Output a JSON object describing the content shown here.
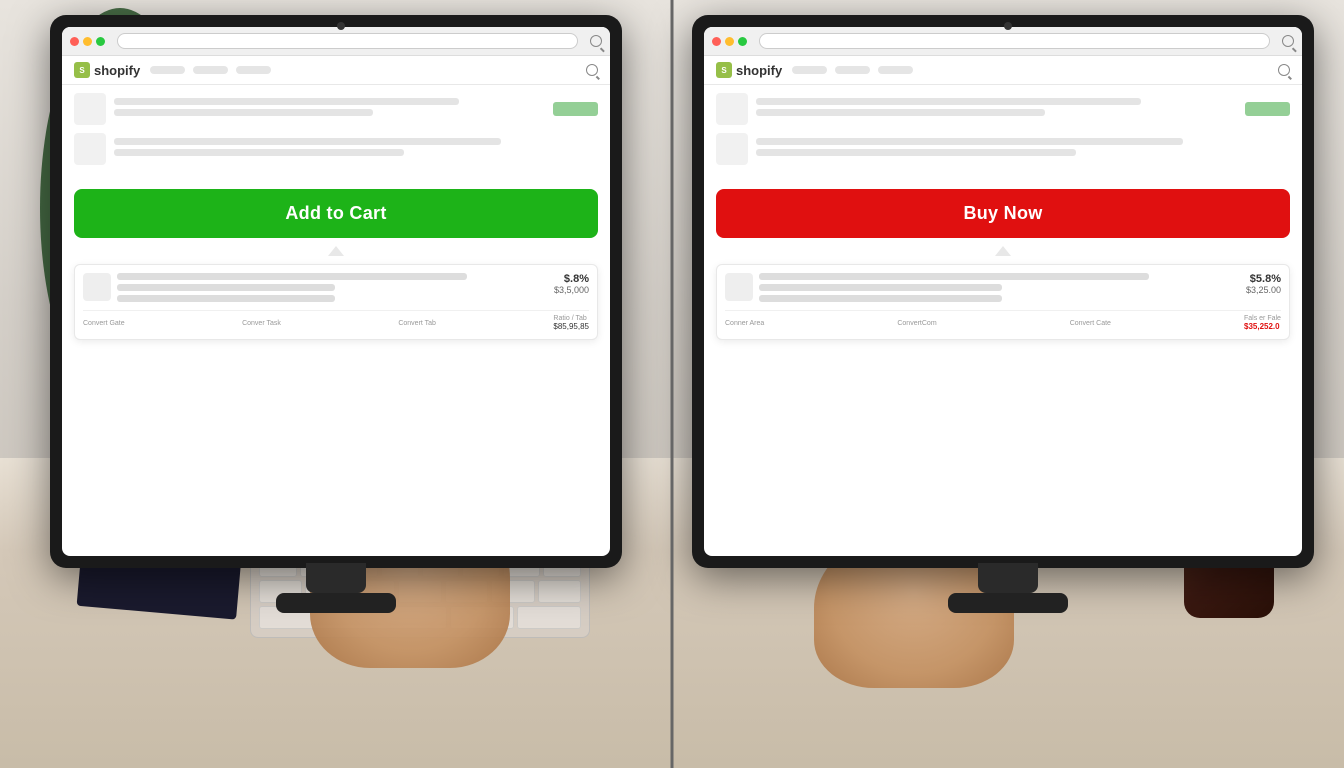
{
  "scene": {
    "background_color": "#c8c8c8",
    "desk_color": "#e8e0d4"
  },
  "left_monitor": {
    "browser": {
      "traffic_lights": [
        "red",
        "yellow",
        "green"
      ],
      "url_bar_placeholder": ""
    },
    "shopify_nav": {
      "logo_text": "shopify",
      "nav_items": [
        "",
        "",
        ""
      ],
      "search_visible": true
    },
    "cta_button": {
      "label": "Add to Cart",
      "color": "#1db318",
      "text_color": "#ffffff"
    },
    "analytics": {
      "rate": "$.8%",
      "revenue": "$3,5,000",
      "footer_cols": [
        {
          "label": "Convert Gate",
          "value": ""
        },
        {
          "label": "Conver Task",
          "value": ""
        },
        {
          "label": "Convert Tab",
          "value": ""
        },
        {
          "label": "Ratio / Tab",
          "value": "$85,95,85"
        }
      ]
    }
  },
  "right_monitor": {
    "browser": {
      "traffic_lights": [
        "red",
        "yellow",
        "green"
      ],
      "url_bar_placeholder": ""
    },
    "shopify_nav": {
      "logo_text": "shopify",
      "nav_items": [
        "",
        "",
        ""
      ],
      "search_visible": true
    },
    "cta_button": {
      "label": "Buy Now",
      "color": "#e01010",
      "text_color": "#ffffff"
    },
    "analytics": {
      "rate": "$5.8%",
      "revenue": "$3,25.00",
      "footer_cols": [
        {
          "label": "Conner Area",
          "value": ""
        },
        {
          "label": "ConvertCom",
          "value": ""
        },
        {
          "label": "Convert Cate",
          "value": ""
        },
        {
          "label": "Fals er Fale",
          "value": "$35,252.0"
        }
      ]
    }
  }
}
